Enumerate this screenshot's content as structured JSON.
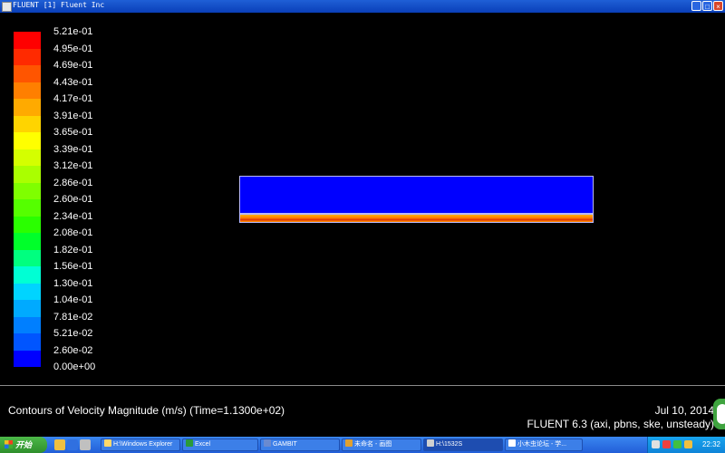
{
  "window": {
    "title": "FLUENT  [1] Fluent Inc",
    "minimize_label": "_",
    "maximize_label": "□",
    "close_label": "×"
  },
  "legend": {
    "labels": [
      "5.21e-01",
      "4.95e-01",
      "4.69e-01",
      "4.43e-01",
      "4.17e-01",
      "3.91e-01",
      "3.65e-01",
      "3.39e-01",
      "3.12e-01",
      "2.86e-01",
      "2.60e-01",
      "2.34e-01",
      "2.08e-01",
      "1.82e-01",
      "1.56e-01",
      "1.30e-01",
      "1.04e-01",
      "7.81e-02",
      "5.21e-02",
      "2.60e-02",
      "0.00e+00"
    ],
    "colors": [
      "#ff0000",
      "#ff2a00",
      "#ff5500",
      "#ff7f00",
      "#ffaa00",
      "#ffd400",
      "#ffff00",
      "#d4ff00",
      "#aaff00",
      "#7fff00",
      "#55ff00",
      "#2aff00",
      "#00ff2a",
      "#00ff7f",
      "#00ffd4",
      "#00d4ff",
      "#00aaff",
      "#007fff",
      "#0055ff",
      "#0000ff"
    ]
  },
  "footer": {
    "caption": "Contours of Velocity Magnitude (m/s)  (Time=1.1300e+02)",
    "date": "Jul 10, 2014",
    "version": "FLUENT 6.3 (axi, pbns, ske, unsteady)"
  },
  "taskbar": {
    "start_label": "开始",
    "tasks": [
      {
        "label": "H:\\Windows Explorer"
      },
      {
        "label": "Excel"
      },
      {
        "label": "GAMBIT"
      },
      {
        "label": "未命名 - 画图"
      },
      {
        "label": "H:\\1532S"
      },
      {
        "label": "小木虫论坛 - 学..."
      }
    ],
    "clock": "22:32"
  }
}
